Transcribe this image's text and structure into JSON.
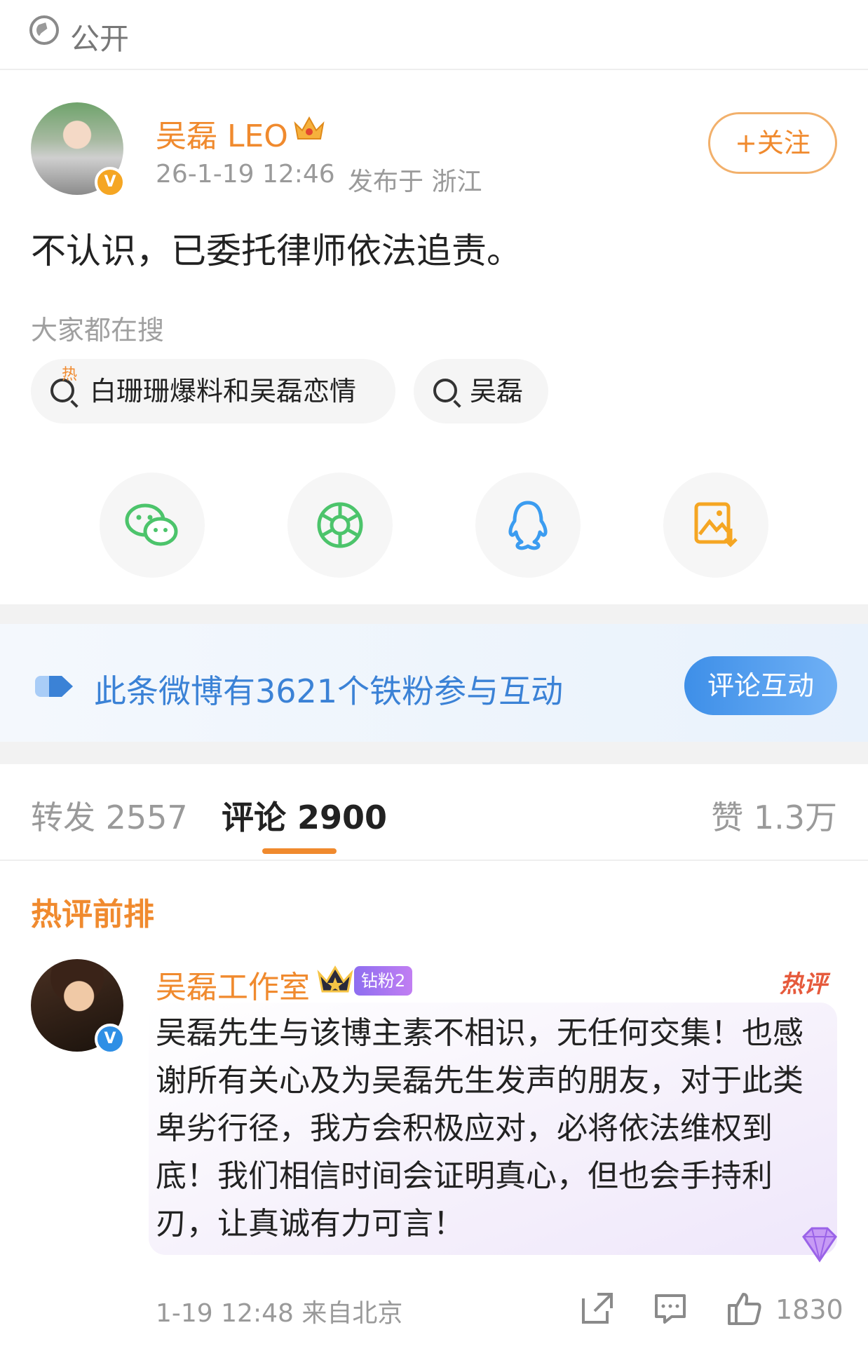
{
  "visibility": {
    "icon": "globe-icon",
    "label": "公开"
  },
  "post": {
    "author": "吴磊 LEO",
    "author_badge_icon": "crown-icon",
    "verified_icon": "verified-orange-v-icon",
    "follow_label": "+关注",
    "timestamp": "26-1-19 12:46",
    "location": "发布于 浙江",
    "text": "不认识，已委托律师依法追责。"
  },
  "hot_search": {
    "label": "大家都在搜",
    "chips": [
      {
        "label": "白珊珊爆料和吴磊恋情",
        "icon": "hot-search-icon",
        "hot_mark": "热"
      },
      {
        "label": "吴磊",
        "icon": "search-icon"
      }
    ]
  },
  "share": [
    {
      "icon": "wechat-icon",
      "color": "#4cc46b"
    },
    {
      "icon": "moments-icon",
      "color": "#4cc46b"
    },
    {
      "icon": "qq-icon",
      "color": "#3b9cf0"
    },
    {
      "icon": "save-image-icon",
      "color": "#f5a623"
    }
  ],
  "fans_banner": {
    "text": "此条微博有3621个铁粉参与互动",
    "button": "评论互动"
  },
  "tabs": {
    "repost": "转发 2557",
    "comment": "评论 2900",
    "likes": "赞 1.3万"
  },
  "hot_comments": {
    "heading": "热评前排",
    "comment": {
      "author": "吴磊工作室",
      "fan_badge": "钻粉2",
      "hot_tag": "热评",
      "text": "吴磊先生与该博主素不相识，无任何交集！也感谢所有关心及为吴磊先生发声的朋友，对于此类卑劣行径，我方会积极应对，必将依法维权到底！我们相信时间会证明真心，但也会手持利刃，让真诚有力可言！",
      "meta": "1-19 12:48 来自北京",
      "like_count": "1830"
    }
  },
  "colors": {
    "accent": "#f08a2e",
    "link_blue": "#3b82d6"
  }
}
